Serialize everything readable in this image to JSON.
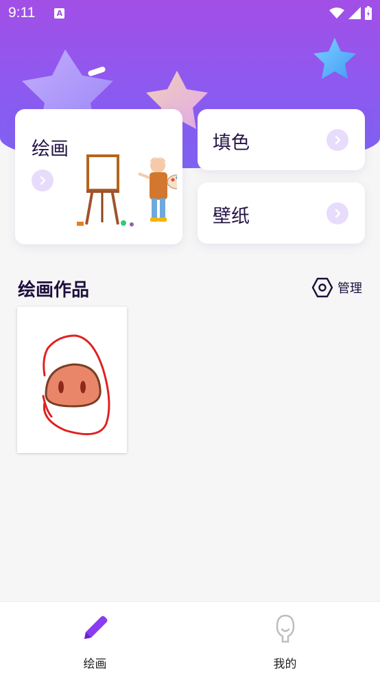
{
  "status_bar": {
    "time": "9:11",
    "badge": "A"
  },
  "cards": {
    "drawing": {
      "label": "绘画"
    },
    "coloring": {
      "label": "填色"
    },
    "wallpaper": {
      "label": "壁纸"
    }
  },
  "works": {
    "title": "绘画作品",
    "manage_label": "管理"
  },
  "tabs": [
    {
      "label": "绘画",
      "icon": "pencil-icon",
      "active": true
    },
    {
      "label": "我的",
      "icon": "profile-icon",
      "active": false
    }
  ],
  "colors": {
    "accent": "#8b3cf2",
    "hero_top": "#a24fe6",
    "hero_bottom": "#7d63f2",
    "arrow_bg": "#e7dcfb"
  }
}
